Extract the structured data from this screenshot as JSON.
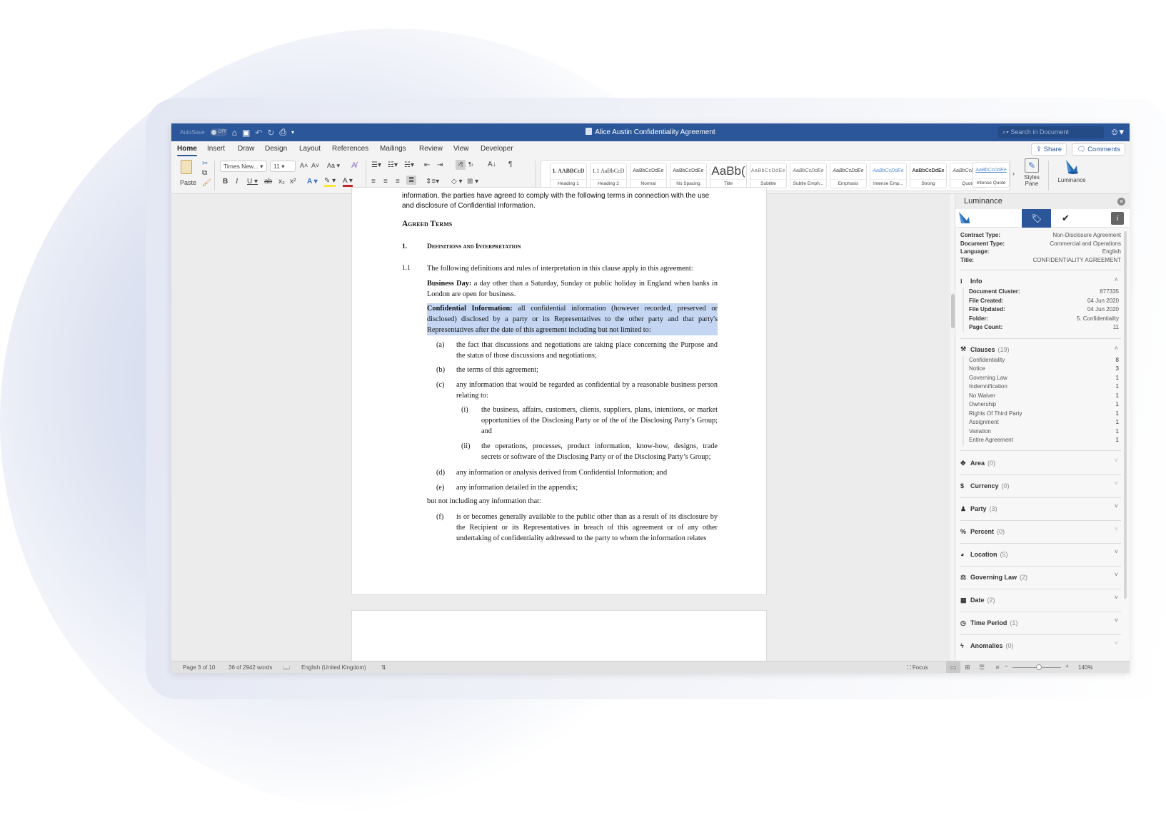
{
  "window": {
    "title": "Alice Austin Confidentiality Agreement",
    "autosave_label": "AutoSave",
    "autosave_state": "OFF",
    "search_placeholder": "Search in Document",
    "brand_color": "#2b579a"
  },
  "quick_access": [
    "home-icon",
    "save-icon",
    "undo-icon",
    "redo-icon",
    "print-icon",
    "customize-icon"
  ],
  "tabs": [
    "Home",
    "Insert",
    "Draw",
    "Design",
    "Layout",
    "References",
    "Mailings",
    "Review",
    "View",
    "Developer"
  ],
  "active_tab": "Home",
  "top_buttons": {
    "share": "Share",
    "comments": "Comments"
  },
  "ribbon": {
    "paste_label": "Paste",
    "font_name": "Times New...",
    "font_size": "11",
    "change_case": "Aa",
    "styles": [
      {
        "preview": "1. AABBCcD",
        "label": "Heading 1"
      },
      {
        "preview": "1.1 AaBbCcD",
        "label": "Heading 2"
      },
      {
        "preview": "AaBbCcDdEe",
        "label": "Normal"
      },
      {
        "preview": "AaBbCcDdEe",
        "label": "No Spacing"
      },
      {
        "preview": "AaBb(",
        "label": "Title"
      },
      {
        "preview": "AaBbCcDdEe",
        "label": "Subtitle"
      },
      {
        "preview": "AaBbCcDdEe",
        "label": "Subtle Emph..."
      },
      {
        "preview": "AaBbCcDdEe",
        "label": "Emphasis"
      },
      {
        "preview": "AaBbCcDdEe",
        "label": "Intense Emp..."
      },
      {
        "preview": "AaBbCcDdEe",
        "label": "Strong"
      },
      {
        "preview": "AaBbCcDdEe",
        "label": "Quote"
      },
      {
        "preview": "AaBbCcDdEe",
        "label": "Intense Quote"
      }
    ],
    "styles_pane_label": "Styles Pane",
    "luminance_label": "Luminance"
  },
  "document": {
    "intro_line1": "information, the parties have agreed to comply with the following terms in connection with the use",
    "intro_line2": "and disclosure of Confidential Information.",
    "heading": "Agreed Terms",
    "section_num": "1.",
    "section_title": "Definitions and Interpretation",
    "clause_num": "1.1",
    "clause_text": "The following definitions and rules of interpretation in this clause apply in this agreement:",
    "business_day_term": "Business Day:",
    "business_day_text": "a day other than a Saturday, Sunday or public holiday in England when banks in London are open for business.",
    "ci_term": "Confidential Information:",
    "ci_text": "all confidential information (however recorded, preserved or disclosed) disclosed by a party or its Representatives to the other party and that party's Representatives after the date of this agreement including but not limited to:",
    "items": [
      {
        "label": "(a)",
        "text": "the fact that discussions and negotiations are taking place concerning the Purpose and the status of those discussions and negotiations;"
      },
      {
        "label": "(b)",
        "text": "the terms of this agreement;"
      },
      {
        "label": "(c)",
        "text": "any information that would be regarded as confidential by a reasonable business person relating to:"
      }
    ],
    "subitems": [
      {
        "label": "(i)",
        "text": "the business, affairs, customers, clients, suppliers, plans, intentions, or market opportunities of the Disclosing Party or of the of the Disclosing Party’s Group; and"
      },
      {
        "label": "(ii)",
        "text": "the operations, processes, product information, know-how, designs, trade secrets or software of the Disclosing Party or of the Disclosing Party’s Group;"
      }
    ],
    "items2": [
      {
        "label": "(d)",
        "text": "any information or analysis derived from Confidential Information; and"
      },
      {
        "label": "(e)",
        "text": "any information detailed in the appendix;"
      }
    ],
    "exclusion_intro": "but not including any information that:",
    "items3": [
      {
        "label": "(f)",
        "text": "is or becomes generally available to the public other than as a result of its disclosure by the Recipient or its Representatives in breach of this agreement or of any other undertaking of confidentiality addressed to the party to whom the information relates"
      }
    ]
  },
  "panel": {
    "title": "Luminance",
    "summary": [
      {
        "k": "Contract Type:",
        "v": "Non-Disclosure Agreement"
      },
      {
        "k": "Document Type:",
        "v": "Commercial and Operations"
      },
      {
        "k": "Language:",
        "v": "English"
      },
      {
        "k": "Title:",
        "v": "CONFIDENTIALITY AGREEMENT"
      }
    ],
    "info": {
      "title": "Info",
      "rows": [
        {
          "k": "Document Cluster:",
          "v": "877335"
        },
        {
          "k": "File Created:",
          "v": "04 Jun 2020"
        },
        {
          "k": "File Updated:",
          "v": "04 Jun 2020"
        },
        {
          "k": "Folder:",
          "v": "5. Confidentiality"
        },
        {
          "k": "Page Count:",
          "v": "11"
        }
      ]
    },
    "clauses": {
      "title": "Clauses",
      "count": "(19)",
      "rows": [
        {
          "k": "Confidentiality",
          "v": "8"
        },
        {
          "k": "Notice",
          "v": "3"
        },
        {
          "k": "Governing Law",
          "v": "1"
        },
        {
          "k": "Indemnification",
          "v": "1"
        },
        {
          "k": "No Waiver",
          "v": "1"
        },
        {
          "k": "Ownership",
          "v": "1"
        },
        {
          "k": "Rights Of Third Party",
          "v": "1"
        },
        {
          "k": "Assignment",
          "v": "1"
        },
        {
          "k": "Variation",
          "v": "1"
        },
        {
          "k": "Entire Agreement",
          "v": "1"
        }
      ]
    },
    "sections": [
      {
        "icon": "move-icon",
        "glyph": "✥",
        "title": "Area",
        "count": "(0)"
      },
      {
        "icon": "dollar-icon",
        "glyph": "$",
        "title": "Currency",
        "count": "(0)"
      },
      {
        "icon": "user-icon",
        "glyph": "♟",
        "title": "Party",
        "count": "(3)"
      },
      {
        "icon": "percent-icon",
        "glyph": "%",
        "title": "Percent",
        "count": "(0)"
      },
      {
        "icon": "globe-icon",
        "glyph": "◕",
        "title": "Location",
        "count": "(5)"
      },
      {
        "icon": "scales-icon",
        "glyph": "⚖",
        "title": "Governing Law",
        "count": "(2)"
      },
      {
        "icon": "calendar-icon",
        "glyph": "▦",
        "title": "Date",
        "count": "(2)"
      },
      {
        "icon": "clock-icon",
        "glyph": "◷",
        "title": "Time Period",
        "count": "(1)"
      },
      {
        "icon": "bolt-icon",
        "glyph": "ϟ",
        "title": "Anomalies",
        "count": "(0)"
      }
    ]
  },
  "status": {
    "page": "Page 3 of 10",
    "words": "36 of 2942 words",
    "language": "English (United Kingdom)",
    "focus": "Focus",
    "zoom": "140%",
    "zoom_value_percent": 140
  }
}
